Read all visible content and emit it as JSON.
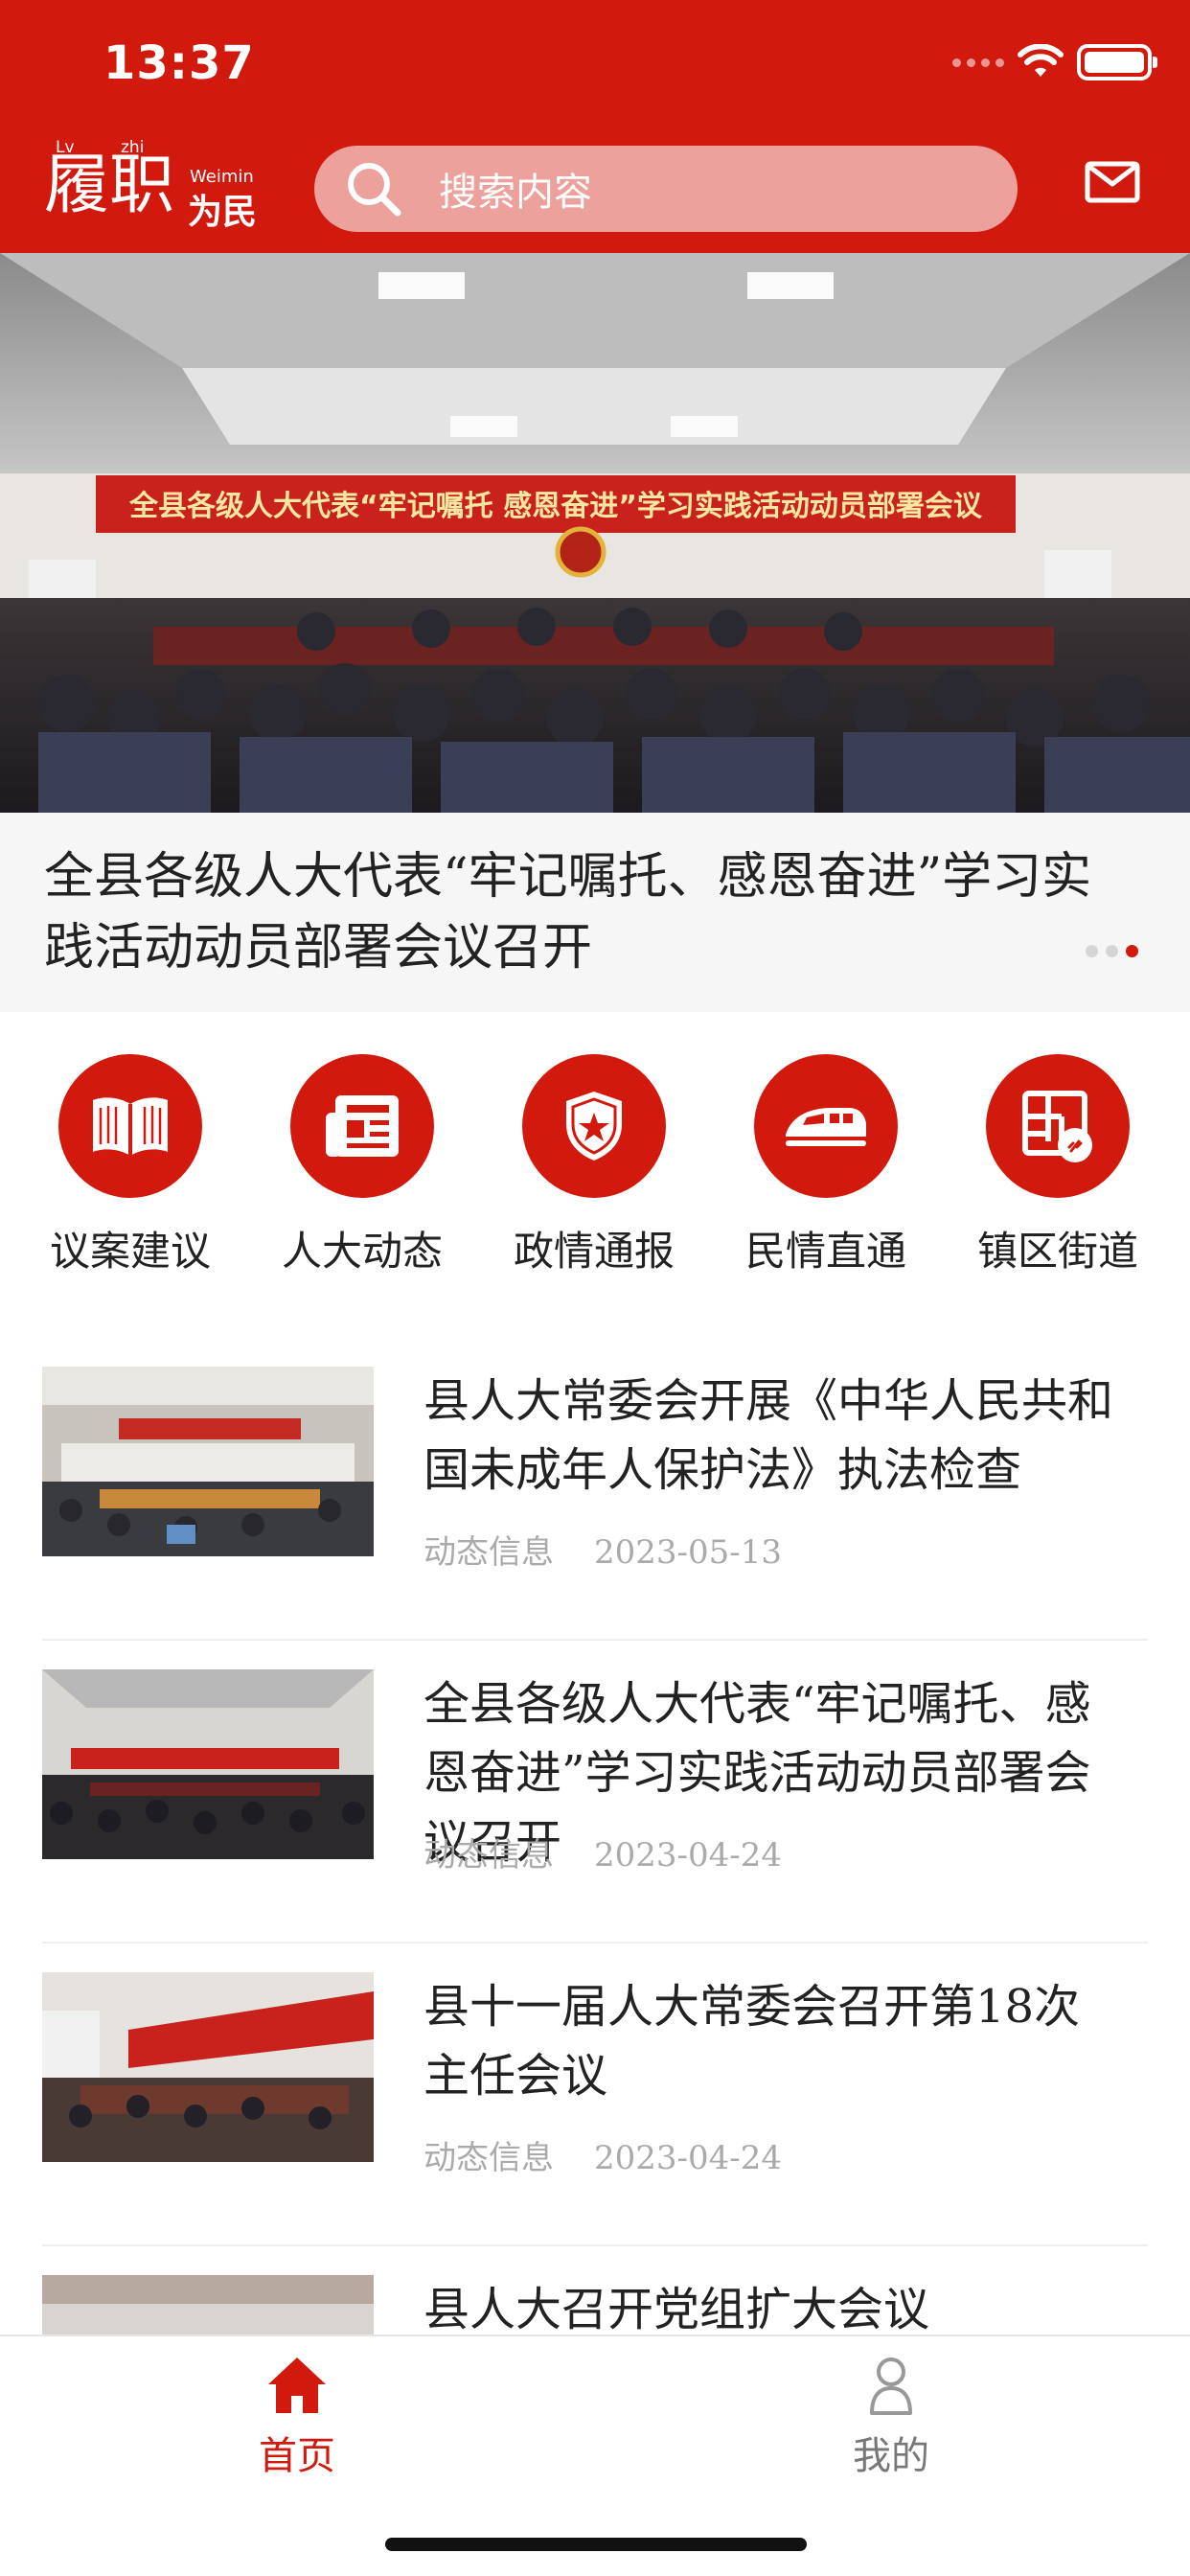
{
  "status_bar": {
    "time": "13:37"
  },
  "header": {
    "logo": {
      "pinyin_1": "Lv",
      "pinyin_2": "zhi",
      "big_text": "履职",
      "pinyin_3": "Weimin",
      "small_text": "为民"
    },
    "search_placeholder": "搜索内容",
    "colors": {
      "brand": "#d2190d",
      "search_bg": "#eda19c"
    }
  },
  "banner": {
    "photo_banner_text": "全县各级人大代表“牢记嘱托 感恩奋进”学习实践活动动员部署会议",
    "caption": "全县各级人大代表“牢记嘱托、感恩奋进”学习实践活动动员部署会议召开",
    "page_count": 3,
    "active_page": 3
  },
  "categories": [
    {
      "label": "议案建议",
      "icon": "book-icon"
    },
    {
      "label": "人大动态",
      "icon": "newspaper-icon"
    },
    {
      "label": "政情通报",
      "icon": "police-badge-icon"
    },
    {
      "label": "民情直通",
      "icon": "train-icon"
    },
    {
      "label": "镇区街道",
      "icon": "map-icon"
    }
  ],
  "news": [
    {
      "title": "县人大常委会开展《中华人民共和国未成年人保护法》执法检查",
      "category": "动态信息",
      "date": "2023-05-13"
    },
    {
      "title": "全县各级人大代表“牢记嘱托、感恩奋进”学习实践活动动员部署会议召开",
      "category": "动态信息",
      "date": "2023-04-24"
    },
    {
      "title": "县十一届人大常委会召开第18次主任会议",
      "category": "动态信息",
      "date": "2023-04-24"
    },
    {
      "title": "县人大召开党组扩大会议",
      "category": "",
      "date": ""
    }
  ],
  "tabbar": {
    "tabs": [
      {
        "label": "首页",
        "icon": "home-icon",
        "active": true
      },
      {
        "label": "我的",
        "icon": "person-icon",
        "active": false
      }
    ]
  }
}
